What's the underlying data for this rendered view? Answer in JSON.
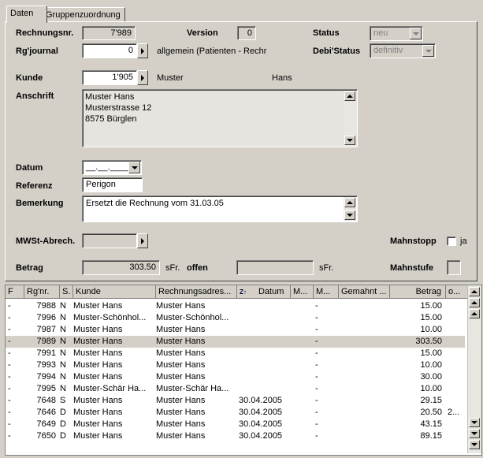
{
  "tabs": [
    "Daten",
    "Gruppenzuordnung"
  ],
  "form": {
    "rechnungsnr_label": "Rechnungsnr.",
    "rechnungsnr": "7'989",
    "version_label": "Version",
    "version": "0",
    "status_label": "Status",
    "status": "neu",
    "rgjournal_label": "Rg'journal",
    "rgjournal": "0",
    "rgjournal_text": "allgemein (Patienten - Rechr",
    "debistatus_label": "Debi'Status",
    "debistatus": "definitiv",
    "kunde_label": "Kunde",
    "kunde_nr": "1'905",
    "kunde_name": "Muster",
    "kunde_vorname": "Hans",
    "anschrift_label": "Anschrift",
    "anschrift_lines": [
      "Muster Hans",
      "Musterstrasse 12",
      "8575 Bürglen"
    ],
    "datum_label": "Datum",
    "datum": "__.__.____",
    "referenz_label": "Referenz",
    "referenz": "Perigon",
    "bemerkung_label": "Bemerkung",
    "bemerkung": "Ersetzt die Rechnung vom 31.03.05",
    "mwst_label": "MWSt-Abrech.",
    "mahnstopp_label": "Mahnstopp",
    "mahnstopp_ja": "ja",
    "betrag_label": "Betrag",
    "betrag": "303.50",
    "currency1": "sFr.",
    "offen_label": "offen",
    "offen": "",
    "currency2": "sFr.",
    "mahnstufe_label": "Mahnstufe"
  },
  "grid": {
    "headers": [
      "F",
      "Rg'nr.",
      "S.",
      "Kunde",
      "Rechnungsadres...",
      "Datum",
      "M...",
      "M...",
      "Gemahnt ...",
      "Betrag",
      "o..."
    ],
    "rows": [
      {
        "f": "-",
        "nr": "7988",
        "s": "N",
        "kunde": "Muster Hans",
        "adr": "Muster Hans",
        "datum": "",
        "m2": "-",
        "betrag": "15.00",
        "o": ""
      },
      {
        "f": "-",
        "nr": "7996",
        "s": "N",
        "kunde": "Muster-Schönhol...",
        "adr": "Muster-Schönhol...",
        "datum": "",
        "m2": "-",
        "betrag": "15.00",
        "o": ""
      },
      {
        "f": "-",
        "nr": "7987",
        "s": "N",
        "kunde": "Muster Hans",
        "adr": "Muster Hans",
        "datum": "",
        "m2": "-",
        "betrag": "10.00",
        "o": ""
      },
      {
        "f": "-",
        "nr": "7989",
        "s": "N",
        "kunde": "Muster Hans",
        "adr": "Muster Hans",
        "datum": "",
        "m2": "-",
        "betrag": "303.50",
        "o": ""
      },
      {
        "f": "-",
        "nr": "7991",
        "s": "N",
        "kunde": "Muster Hans",
        "adr": "Muster Hans",
        "datum": "",
        "m2": "-",
        "betrag": "15.00",
        "o": ""
      },
      {
        "f": "-",
        "nr": "7993",
        "s": "N",
        "kunde": "Muster Hans",
        "adr": "Muster Hans",
        "datum": "",
        "m2": "-",
        "betrag": "10.00",
        "o": ""
      },
      {
        "f": "-",
        "nr": "7994",
        "s": "N",
        "kunde": "Muster Hans",
        "adr": "Muster Hans",
        "datum": "",
        "m2": "-",
        "betrag": "30.00",
        "o": ""
      },
      {
        "f": "-",
        "nr": "7995",
        "s": "N",
        "kunde": "Muster-Schär Ha...",
        "adr": "Muster-Schär Ha...",
        "datum": "",
        "m2": "-",
        "betrag": "10.00",
        "o": ""
      },
      {
        "f": "-",
        "nr": "7648",
        "s": "S",
        "kunde": "Muster Hans",
        "adr": "Muster Hans",
        "datum": "30.04.2005",
        "m2": "-",
        "betrag": "29.15",
        "o": ""
      },
      {
        "f": "-",
        "nr": "7646",
        "s": "D",
        "kunde": "Muster Hans",
        "adr": "Muster Hans",
        "datum": "30.04.2005",
        "m2": "-",
        "betrag": "20.50",
        "o": "2..."
      },
      {
        "f": "-",
        "nr": "7649",
        "s": "D",
        "kunde": "Muster Hans",
        "adr": "Muster Hans",
        "datum": "30.04.2005",
        "m2": "-",
        "betrag": "43.15",
        "o": ""
      },
      {
        "f": "-",
        "nr": "7650",
        "s": "D",
        "kunde": "Muster Hans",
        "adr": "Muster Hans",
        "datum": "30.04.2005",
        "m2": "-",
        "betrag": "89.15",
        "o": ""
      }
    ]
  }
}
